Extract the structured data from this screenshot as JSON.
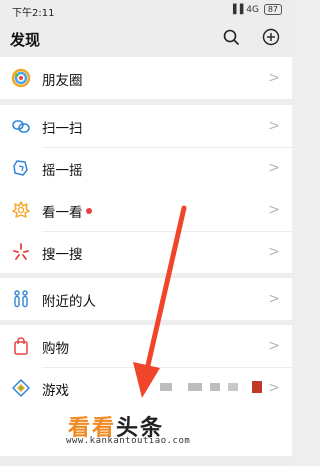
{
  "status": {
    "time": "下午2:11",
    "network": "4G",
    "battery": "87"
  },
  "header": {
    "title": "发现"
  },
  "menu": {
    "moments": "朋友圈",
    "scan": "扫一扫",
    "shake": "摇一摇",
    "top_stories": "看一看",
    "search": "搜一搜",
    "nearby": "附近的人",
    "shopping": "购物",
    "games": "游戏",
    "chevron": ">"
  },
  "watermark": {
    "brand_part1": "看看",
    "brand_part2": "头条",
    "url": "www.kankantoutiao.com"
  },
  "colors": {
    "accent_red": "#e64340",
    "annotation_arrow": "#f0452a",
    "watermark_orange": "#f08a24"
  },
  "icons": {
    "moments": "moments-icon",
    "scan": "scan-icon",
    "shake": "shake-icon",
    "top_stories": "top-stories-icon",
    "search": "search-feature-icon",
    "nearby": "nearby-people-icon",
    "shopping": "shopping-bag-icon",
    "games": "games-icon"
  }
}
